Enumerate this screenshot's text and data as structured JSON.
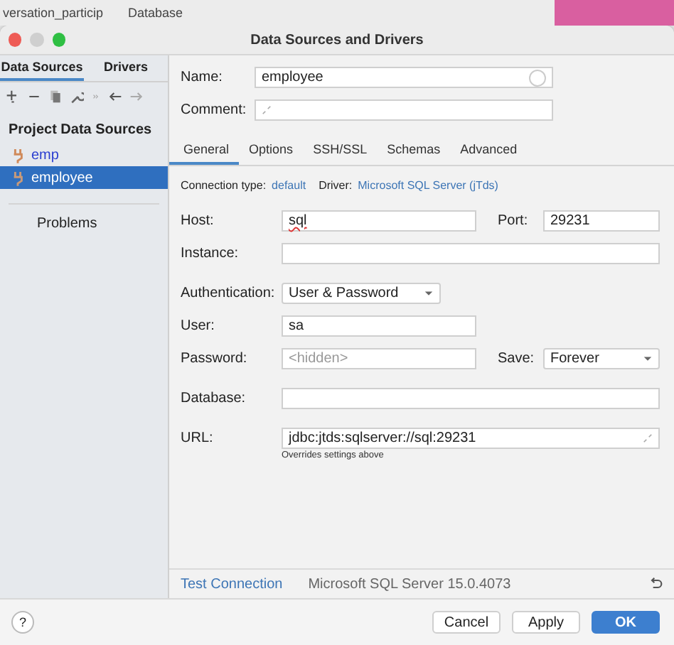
{
  "background_app": {
    "tab_label": "versation_particip",
    "panel_title": "Database"
  },
  "window": {
    "title": "Data Sources and Drivers"
  },
  "sidebar": {
    "tabs": [
      {
        "label": "Data Sources",
        "selected": true
      },
      {
        "label": "Drivers",
        "selected": false
      }
    ],
    "section_title": "Project Data Sources",
    "items": [
      {
        "label": "emp",
        "selected": false
      },
      {
        "label": "employee",
        "selected": true
      }
    ],
    "problems_label": "Problems"
  },
  "header": {
    "name": {
      "label": "Name:",
      "value": "employee"
    },
    "comment": {
      "label": "Comment:"
    }
  },
  "tabs": [
    {
      "label": "General",
      "selected": true
    },
    {
      "label": "Options",
      "selected": false
    },
    {
      "label": "SSH/SSL",
      "selected": false
    },
    {
      "label": "Schemas",
      "selected": false
    },
    {
      "label": "Advanced",
      "selected": false
    }
  ],
  "connection": {
    "type_label": "Connection type:",
    "type_value": "default",
    "driver_label": "Driver:",
    "driver_value": "Microsoft SQL Server (jTds)"
  },
  "field_groups": [
    [
      [
        {
          "label": "Host:",
          "kind": "text",
          "value": "sql",
          "misspelled": true
        },
        {
          "label": "Port:",
          "kind": "text",
          "value": "29231"
        }
      ],
      [
        {
          "label": "Instance:",
          "kind": "text",
          "wide": true
        }
      ]
    ],
    [
      [
        {
          "label": "Authentication:",
          "kind": "dropdown",
          "value": "User & Password"
        }
      ],
      [
        {
          "label": "User:",
          "kind": "text",
          "value": "sa"
        }
      ],
      [
        {
          "label": "Password:",
          "kind": "text",
          "placeholder": "<hidden>"
        },
        {
          "label": "Save:",
          "kind": "dropdown",
          "value": "Forever"
        }
      ]
    ],
    [
      [
        {
          "label": "Database:",
          "kind": "text",
          "wide": true
        }
      ]
    ],
    [
      [
        {
          "label": "URL:",
          "kind": "text",
          "value": "jdbc:jtds:sqlserver://sql:29231",
          "wide": true,
          "expandable": true,
          "hint": "Overrides settings above"
        }
      ]
    ]
  ],
  "status": {
    "link": "Test Connection",
    "version": "Microsoft SQL Server 15.0.4073"
  },
  "help_button": "?",
  "buttons": [
    {
      "label": "Cancel",
      "default": false
    },
    {
      "label": "Apply",
      "default": false
    },
    {
      "label": "OK",
      "default": true
    }
  ]
}
